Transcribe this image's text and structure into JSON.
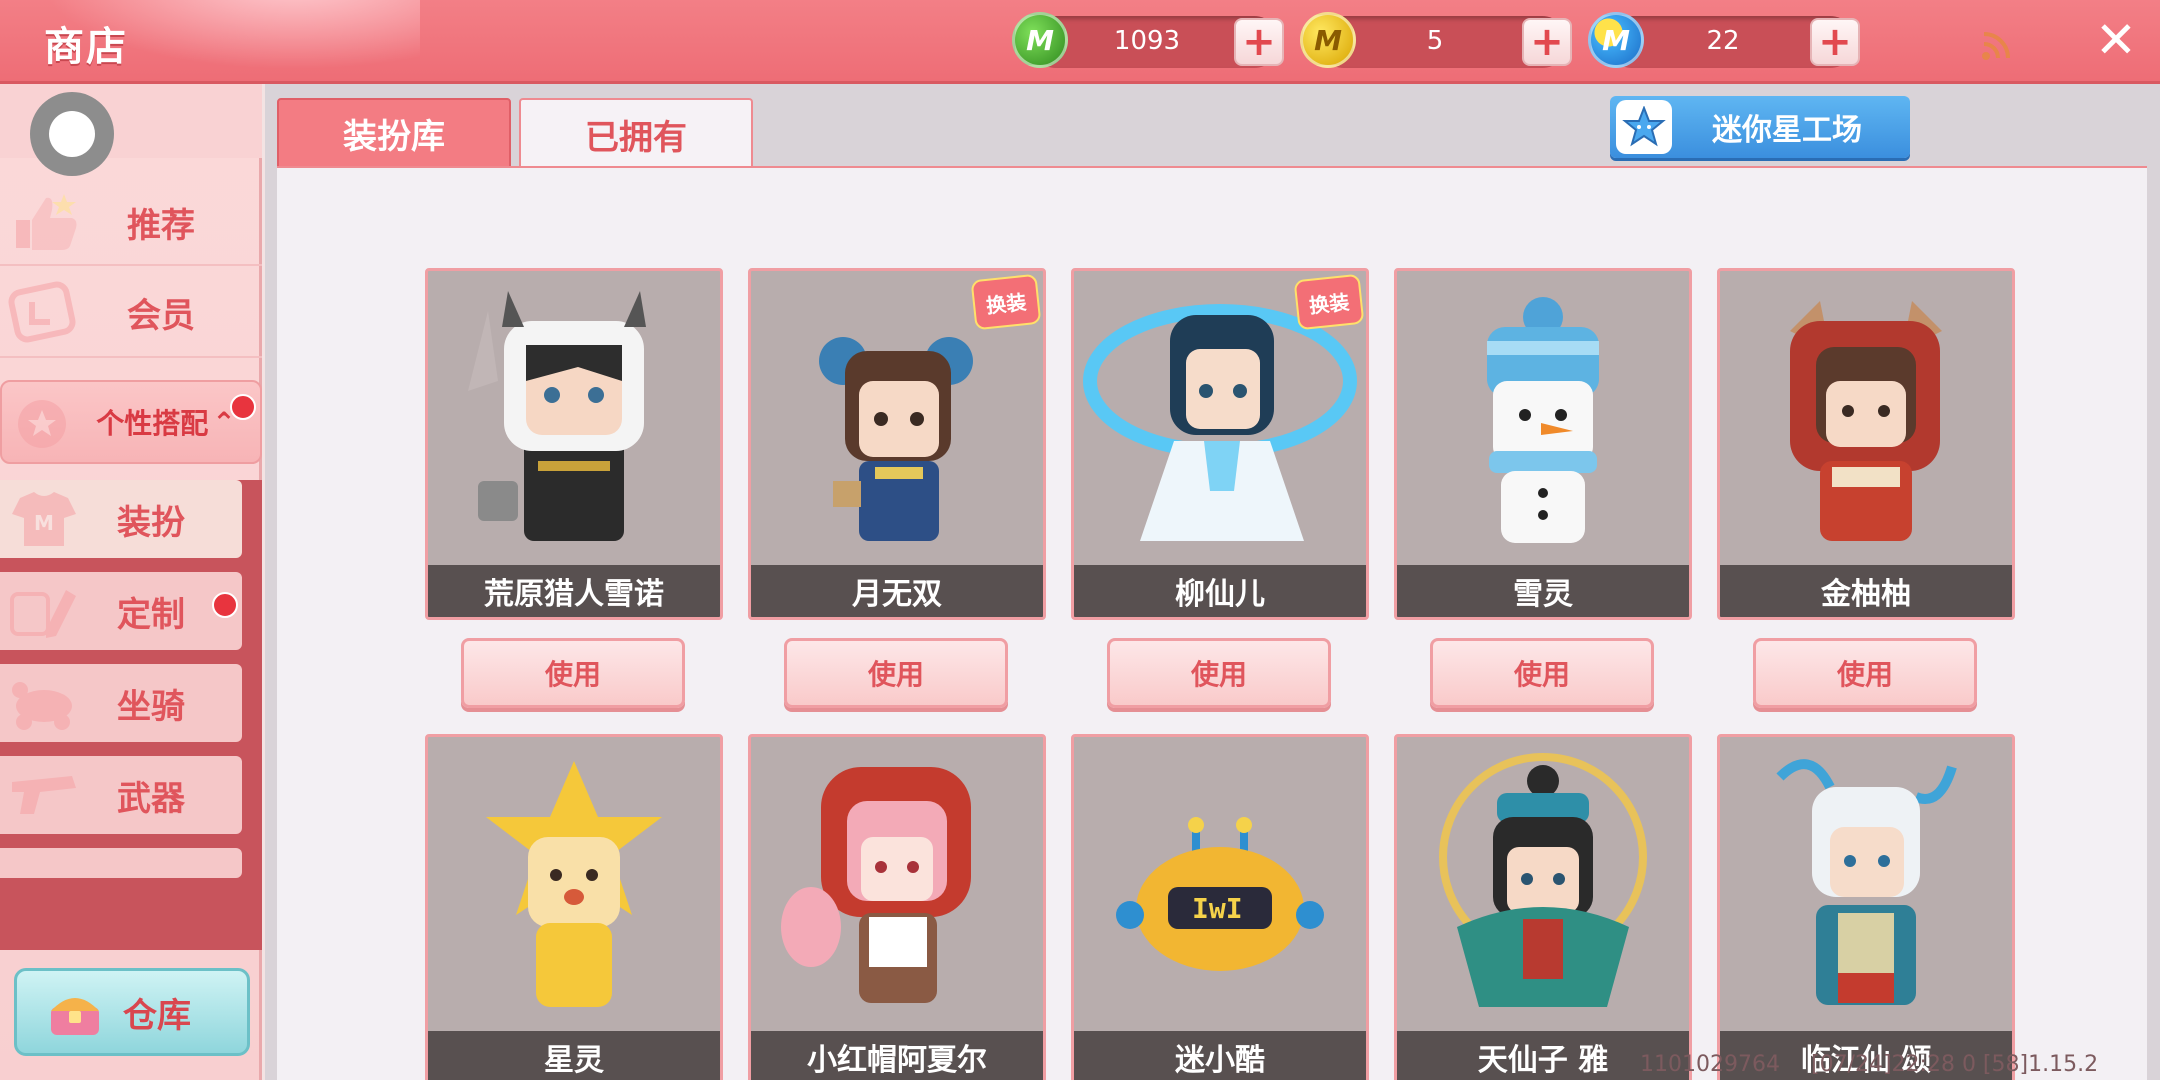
{
  "header": {
    "title": "商店",
    "currencies": [
      {
        "icon": "green-coin-icon",
        "amount": "1093"
      },
      {
        "icon": "gold-coin-icon",
        "amount": "5"
      },
      {
        "icon": "mini-coin-icon",
        "amount": "22"
      }
    ],
    "plus_symbol": "+",
    "close_symbol": "✕"
  },
  "sidebar": {
    "items": [
      {
        "label": "推荐",
        "icon": "thumbs-up-icon"
      },
      {
        "label": "会员",
        "icon": "vip-icon"
      },
      {
        "label": "个性搭配",
        "icon": "badge-icon",
        "expanded": true,
        "caret": "⌃"
      }
    ],
    "sub_items": [
      {
        "label": "装扮",
        "icon": "shirt-icon",
        "active": true
      },
      {
        "label": "定制",
        "icon": "pencil-icon"
      },
      {
        "label": "坐骑",
        "icon": "mount-icon"
      },
      {
        "label": "武器",
        "icon": "gun-icon"
      }
    ],
    "warehouse_label": "仓库"
  },
  "tabs": [
    {
      "label": "装扮库",
      "active": false
    },
    {
      "label": "已拥有",
      "active": true
    }
  ],
  "workshop_label": "迷你星工场",
  "cards_row1": [
    {
      "name": "荒原猎人雪诺",
      "button": "使用",
      "badge": ""
    },
    {
      "name": "月无双",
      "button": "使用",
      "badge": "换装"
    },
    {
      "name": "柳仙儿",
      "button": "使用",
      "badge": "换装"
    },
    {
      "name": "雪灵",
      "button": "使用",
      "badge": ""
    },
    {
      "name": "金柚柚",
      "button": "使用",
      "badge": ""
    }
  ],
  "cards_row2": [
    {
      "name": "星灵"
    },
    {
      "name": "小红帽阿夏尔"
    },
    {
      "name": "迷小酷"
    },
    {
      "name": "天仙子 雅"
    },
    {
      "name": "临江仙 颂"
    }
  ],
  "status": {
    "uid": "1101029764",
    "build": "[07/24]22:28 0 [58]1.15.2"
  },
  "colors": {
    "accent": "#f37c83",
    "accent_text": "#e0555c",
    "workshop_blue": "#4a9ee8"
  }
}
